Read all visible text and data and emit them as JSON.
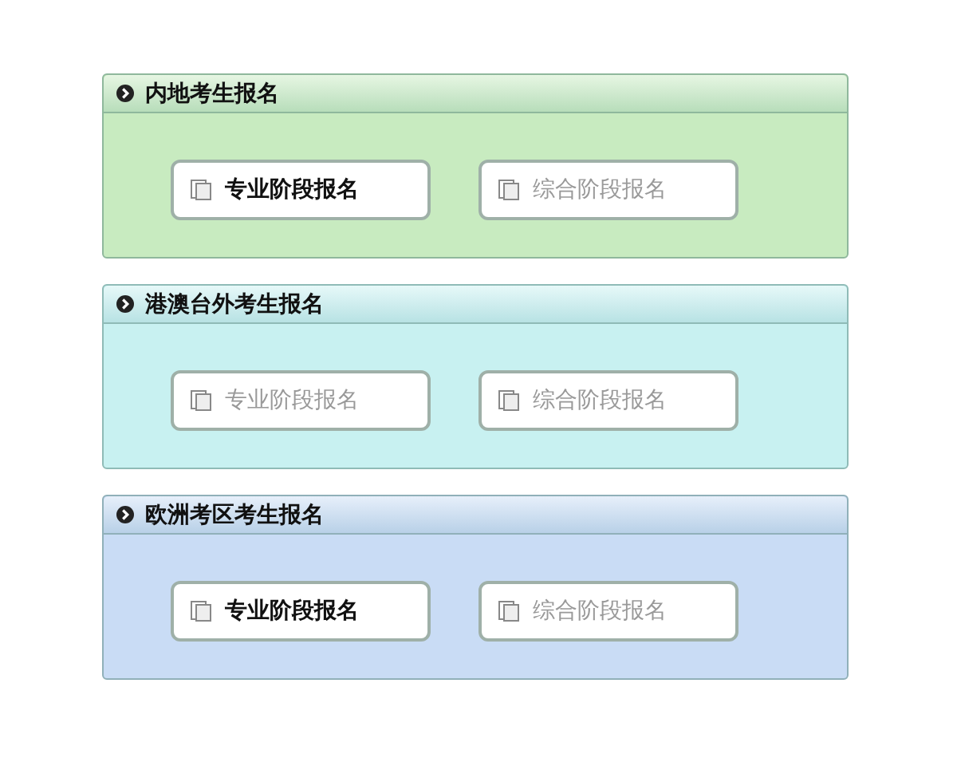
{
  "sections": [
    {
      "title": "内地考生报名",
      "color": "#c8ebc0",
      "buttons": [
        {
          "label": "专业阶段报名",
          "disabled": false
        },
        {
          "label": "综合阶段报名",
          "disabled": true
        }
      ]
    },
    {
      "title": "港澳台外考生报名",
      "color": "#c8f1f1",
      "buttons": [
        {
          "label": "专业阶段报名",
          "disabled": true
        },
        {
          "label": "综合阶段报名",
          "disabled": true
        }
      ]
    },
    {
      "title": "欧洲考区考生报名",
      "color": "#c9dcf5",
      "buttons": [
        {
          "label": "专业阶段报名",
          "disabled": false
        },
        {
          "label": "综合阶段报名",
          "disabled": true
        }
      ]
    }
  ]
}
